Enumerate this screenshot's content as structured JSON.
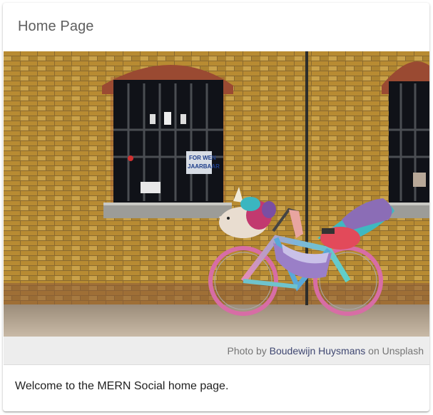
{
  "card": {
    "title": "Home Page",
    "welcome_text": "Welcome to the MERN Social home page."
  },
  "caption": {
    "prefix": "Photo by",
    "author": "Boudewijn Huysmans",
    "middle": "on",
    "source": "Unsplash"
  },
  "photo": {
    "sign_text": "FOR WEN JAARBAAR"
  },
  "colors": {
    "title": "#5f5f5f",
    "link": "#3f4771",
    "caption_bg": "#ededed"
  }
}
